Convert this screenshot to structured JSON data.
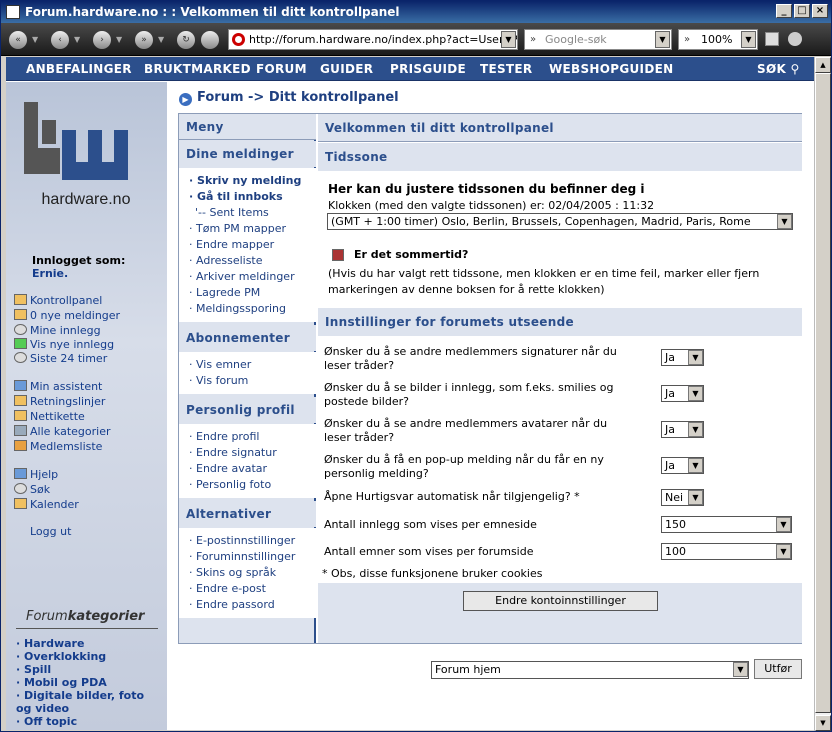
{
  "window": {
    "title": "Forum.hardware.no : : Velkommen til ditt kontrollpanel"
  },
  "browser": {
    "url": "http://forum.hardware.no/index.php?act=UserCP&",
    "search_placeholder": "Google-søk",
    "zoom": "100%"
  },
  "sitenav": [
    "ANBEFALINGER",
    "BRUKTMARKED",
    "FORUM",
    "GUIDER",
    "PRISGUIDE",
    "TESTER",
    "WEBSHOPGUIDEN",
    "SØK"
  ],
  "logo_text": "hardware.no",
  "left": {
    "logged_in_label": "Innlogget som:",
    "user": "Ernie.",
    "links1": [
      "Kontrollpanel",
      "0 nye meldinger",
      "Mine innlegg",
      "Vis nye innlegg",
      "Siste 24 timer"
    ],
    "links2": [
      "Min assistent",
      "Retningslinjer",
      "Nettikette",
      "Alle kategorier",
      "Medlemsliste"
    ],
    "links3": [
      "Hjelp",
      "Søk",
      "Kalender"
    ],
    "logout": "Logg ut",
    "cat_title_a": "Forum",
    "cat_title_b": "kategorier",
    "categories": [
      "Hardware",
      "Overklokking",
      "Spill",
      "Mobil og PDA",
      "Digitale bilder, foto",
      "og video",
      "Off topic"
    ]
  },
  "breadcrumb": "Forum -> Ditt kontrollpanel",
  "menu": {
    "title": "Meny",
    "sections": [
      {
        "title": "Dine meldinger",
        "items": [
          "Skriv ny melding",
          "Gå til innboks",
          "'-- Sent Items",
          "Tøm PM mapper",
          "Endre mapper",
          "Adresseliste",
          "Arkiver meldinger",
          "Lagrede PM",
          "Meldingssporing"
        ]
      },
      {
        "title": "Abonnementer",
        "items": [
          "Vis emner",
          "Vis forum"
        ]
      },
      {
        "title": "Personlig profil",
        "items": [
          "Endre profil",
          "Endre signatur",
          "Endre avatar",
          "Personlig foto"
        ]
      },
      {
        "title": "Alternativer",
        "items": [
          "E-postinnstillinger",
          "Foruminnstillinger",
          "Skins og språk",
          "Endre e-post",
          "Endre passord"
        ]
      }
    ]
  },
  "main": {
    "title": "Velkommen til ditt kontrollpanel",
    "tz_head": "Tidssone",
    "tz_heading": "Her kan du justere tidssonen du befinner deg i",
    "tz_clock": "Klokken (med den valgte tidssonen) er: 02/04/2005 : 11:32",
    "tz_select": "(GMT + 1:00 timer) Oslo, Berlin, Brussels, Copenhagen, Madrid, Paris, Rome",
    "dst_label": "Er det sommertid?",
    "dst_help1": "(Hvis du har valgt rett tidssone, men klokken er en time feil, marker eller fjern",
    "dst_help2": "markeringen av denne boksen for å rette klokken)",
    "look_head": "Innstillinger for forumets utseende",
    "q1a": "Ønsker du å se andre medlemmers signaturer når du",
    "q1b": "leser tråder?",
    "v1": "Ja",
    "q2a": "Ønsker du å se bilder i innlegg, som f.eks. smilies og",
    "q2b": "postede bilder?",
    "v2": "Ja",
    "q3a": "Ønsker du å se andre medlemmers avatarer når du",
    "q3b": "leser tråder?",
    "v3": "Ja",
    "q4a": "Ønsker du å få en pop-up melding når du får en ny",
    "q4b": "personlig melding?",
    "v4": "Ja",
    "q5": "Åpne Hurtigsvar automatisk når tilgjengelig? *",
    "v5": "Nei",
    "q6": "Antall innlegg som vises per emneside",
    "v6": "150",
    "q7": "Antall emner som vises per forumside",
    "v7": "100",
    "note": "* Obs, disse funksjonene bruker cookies",
    "submit": "Endre kontoinnstillinger"
  },
  "jump": {
    "value": "Forum hjem",
    "go": "Utfør"
  }
}
